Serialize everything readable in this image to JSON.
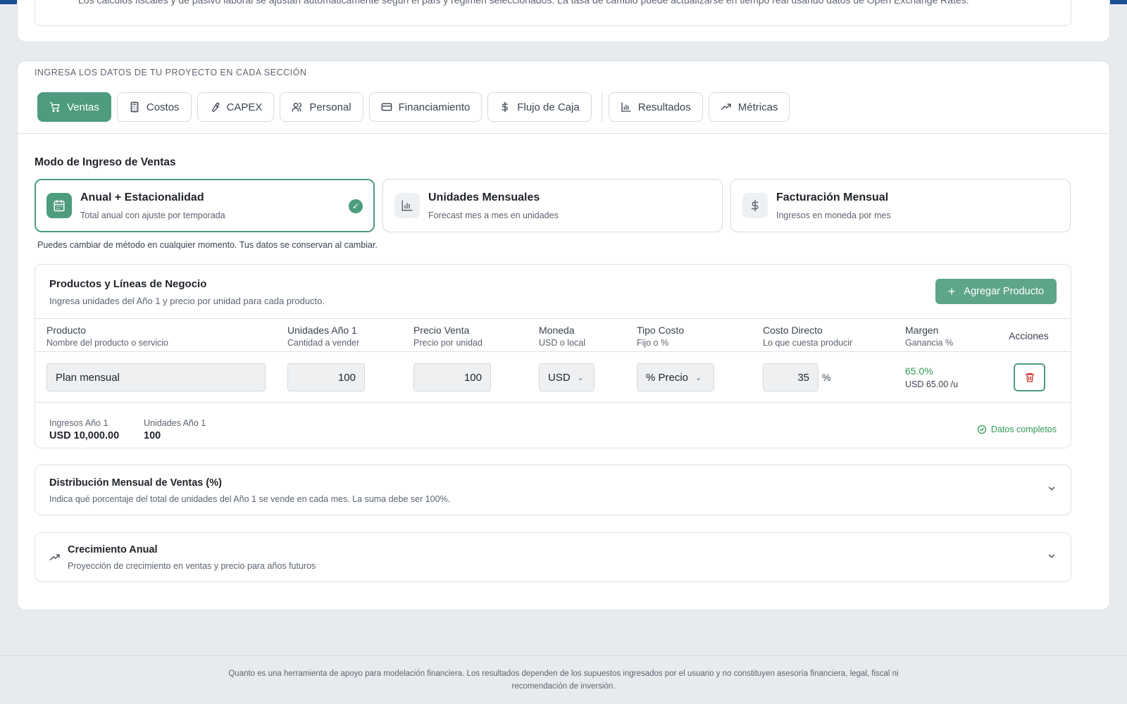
{
  "info": {
    "text": "Los cálculos fiscales y de pasivo laboral se ajustan automáticamente según el país y régimen seleccionados. La tasa de cambio puede actualizarse en tiempo real usando datos de Open Exchange Rates."
  },
  "main": {
    "hint": "INGRESA LOS DATOS DE TU PROYECTO EN CADA SECCIÓN",
    "tabs": [
      {
        "label": "Ventas",
        "icon": "cart-icon",
        "active": true
      },
      {
        "label": "Costos",
        "icon": "calculator-icon"
      },
      {
        "label": "CAPEX",
        "icon": "wrench-icon"
      },
      {
        "label": "Personal",
        "icon": "users-icon"
      },
      {
        "label": "Financiamiento",
        "icon": "credit-card-icon"
      },
      {
        "label": "Flujo de Caja",
        "icon": "dollar-icon"
      },
      {
        "label": "Resultados",
        "icon": "bar-chart-icon"
      },
      {
        "label": "Métricas",
        "icon": "trending-up-icon"
      }
    ]
  },
  "sales_mode": {
    "title": "Modo de Ingreso de Ventas",
    "options": [
      {
        "name": "Anual + Estacionalidad",
        "desc": "Total anual con ajuste por temporada",
        "icon": "calendar-icon",
        "selected": true
      },
      {
        "name": "Unidades Mensuales",
        "desc": "Forecast mes a mes en unidades",
        "icon": "bar-chart-icon"
      },
      {
        "name": "Facturación Mensual",
        "desc": "Ingresos en moneda por mes",
        "icon": "dollar-icon"
      }
    ],
    "note": "Puedes cambiar de método en cualquier momento. Tus datos se conservan al cambiar."
  },
  "products": {
    "title": "Productos y Líneas de Negocio",
    "subtitle": "Ingresa unidades del Año 1 y precio por unidad para cada producto.",
    "add_label": "Agregar Producto",
    "columns": [
      {
        "title": "Producto",
        "sub": "Nombre del producto o servicio"
      },
      {
        "title": "Unidades Año 1",
        "sub": "Cantidad a vender"
      },
      {
        "title": "Precio Venta",
        "sub": "Precio por unidad"
      },
      {
        "title": "Moneda",
        "sub": "USD o local"
      },
      {
        "title": "Tipo Costo",
        "sub": "Fijo o %"
      },
      {
        "title": "Costo Directo",
        "sub": "Lo que cuesta producir"
      },
      {
        "title": "Margen",
        "sub": "Ganancia %"
      },
      {
        "title": "Acciones",
        "sub": ""
      }
    ],
    "row": {
      "name": "Plan mensual",
      "units": "100",
      "price": "100",
      "currency": "USD",
      "cost_type": "% Precio",
      "direct_cost": "35",
      "pct_symbol": "%",
      "margin_pct": "65.0%",
      "margin_unit": "USD 65.00 /u"
    },
    "summary": {
      "revenue_label": "Ingresos Año 1",
      "revenue_value": "USD 10,000.00",
      "units_label": "Unidades Año 1",
      "units_value": "100",
      "status": "Datos completos"
    }
  },
  "distribution": {
    "title": "Distribución Mensual de Ventas (%)",
    "subtitle": "Indica qué porcentaje del total de unidades del Año 1 se vende en cada mes. La suma debe ser 100%."
  },
  "growth": {
    "title": "Crecimiento Anual",
    "subtitle": "Proyección de crecimiento en ventas y precio para años futuros"
  },
  "footer": {
    "line1": "Quanto es una herramienta de apoyo para modelación financiera. Los resultados dependen de los supuestos ingresados por el usuario y no constituyen asesoría financiera, legal, fiscal ni",
    "line2": "recomendación de inversión."
  },
  "colors": {
    "accent": "#4d9c7e",
    "brand_bar": "#1d4f91",
    "success": "#2f9a55",
    "danger": "#d32f2f"
  }
}
